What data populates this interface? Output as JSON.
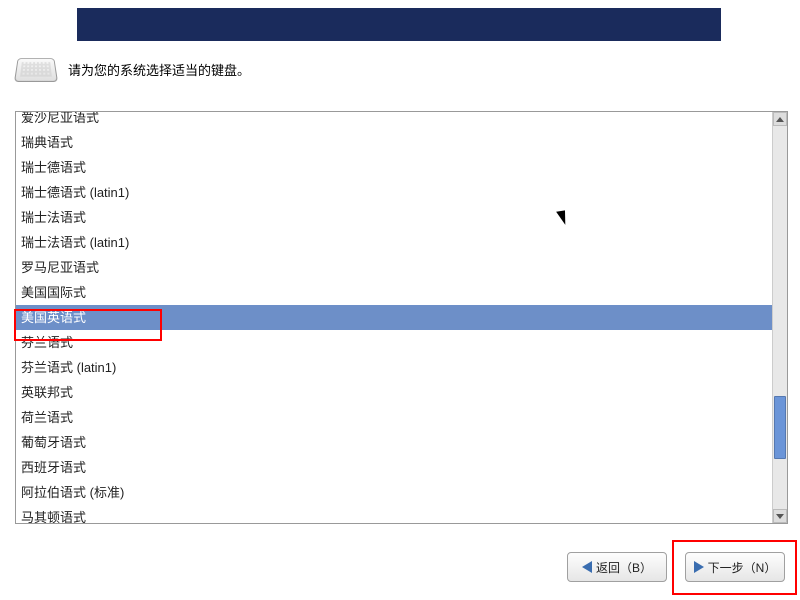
{
  "instruction": "请为您的系统选择适当的键盘。",
  "keyboard_layouts": [
    "爱沙尼亚语式",
    "瑞典语式",
    "瑞士德语式",
    "瑞士德语式 (latin1)",
    "瑞士法语式",
    "瑞士法语式 (latin1)",
    "罗马尼亚语式",
    "美国国际式",
    "美国英语式",
    "芬兰语式",
    "芬兰语式 (latin1)",
    "英联邦式",
    "荷兰语式",
    "葡萄牙语式",
    "西班牙语式",
    "阿拉伯语式 (标准)",
    "马其顿语式"
  ],
  "selected_index": 8,
  "buttons": {
    "back": "返回（B）",
    "next": "下一步（N）"
  }
}
